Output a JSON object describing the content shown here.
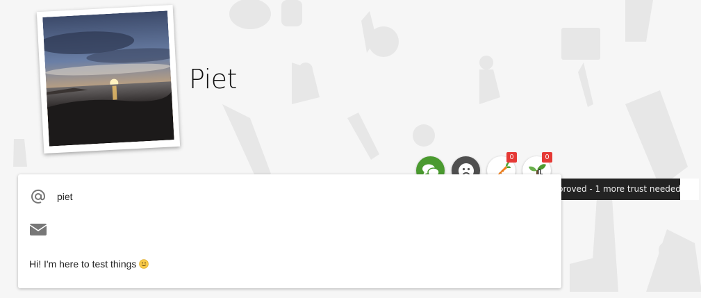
{
  "profile": {
    "name": "Piet",
    "photo_alt": "sunset-over-water-photo"
  },
  "card": {
    "username": "piet",
    "email": "",
    "bio": "Hi! I'm here to test things"
  },
  "actions": [
    {
      "name": "chat",
      "icon": "chat-bubbles-icon",
      "color": "#4a9a2f"
    },
    {
      "name": "report",
      "icon": "frown-face-icon",
      "color": "#4f4f4f"
    },
    {
      "name": "carrot",
      "icon": "carrot-icon",
      "count": "0"
    },
    {
      "name": "trust",
      "icon": "sprout-icon",
      "count": "0"
    }
  ],
  "tooltip": {
    "text": "Approved - 1 more trust needed"
  },
  "colors": {
    "badge": "#e53935",
    "chat": "#4a9a2f",
    "tooltip_bg": "#232323"
  }
}
